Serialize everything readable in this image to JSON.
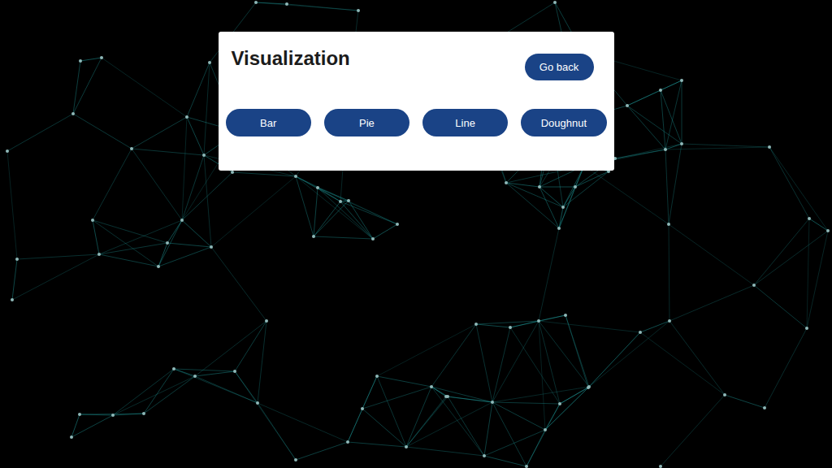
{
  "window": {
    "title": "Visualization"
  },
  "header": {
    "back_button": "Go back"
  },
  "chart_buttons": [
    "Bar",
    "Pie",
    "Line",
    "Doughnut"
  ]
}
